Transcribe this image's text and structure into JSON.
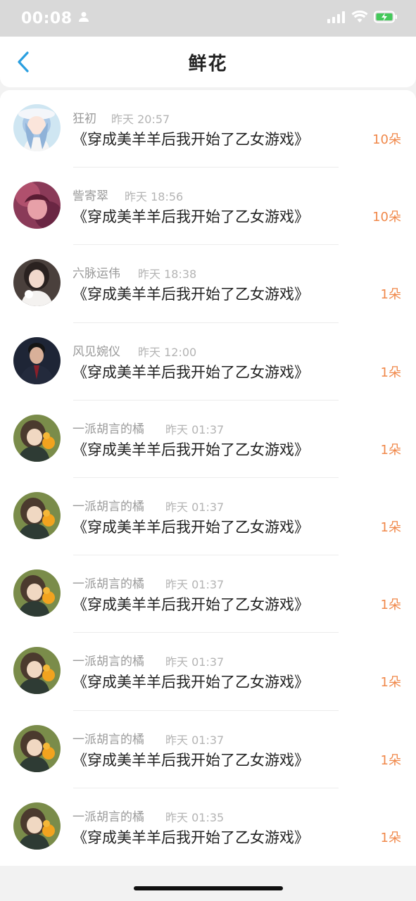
{
  "status_bar": {
    "time": "00:08"
  },
  "nav": {
    "title": "鲜花",
    "back_icon": "chevron-left-icon"
  },
  "colors": {
    "accent": "#2a9fe0",
    "count": "#f0884a",
    "battery": "#44c95a"
  },
  "records": [
    {
      "name": "狂初",
      "time": "昨天 20:57",
      "book": "《穿成美羊羊后我开始了乙女游戏》",
      "count": "10朵",
      "avatar": "anime-girl"
    },
    {
      "name": "訾寄翠",
      "time": "昨天 18:56",
      "book": "《穿成美羊羊后我开始了乙女游戏》",
      "count": "10朵",
      "avatar": "pink-girl"
    },
    {
      "name": "六脉运伟",
      "time": "昨天 18:38",
      "book": "《穿成美羊羊后我开始了乙女游戏》",
      "count": "1朵",
      "avatar": "woman-photo"
    },
    {
      "name": "风见婉仪",
      "time": "昨天 12:00",
      "book": "《穿成美羊羊后我开始了乙女游戏》",
      "count": "1朵",
      "avatar": "man-suit"
    },
    {
      "name": "一派胡言的橘",
      "time": "昨天 01:37",
      "book": "《穿成美羊羊后我开始了乙女游戏》",
      "count": "1朵",
      "avatar": "girl-orange"
    },
    {
      "name": "一派胡言的橘",
      "time": "昨天 01:37",
      "book": "《穿成美羊羊后我开始了乙女游戏》",
      "count": "1朵",
      "avatar": "girl-orange"
    },
    {
      "name": "一派胡言的橘",
      "time": "昨天 01:37",
      "book": "《穿成美羊羊后我开始了乙女游戏》",
      "count": "1朵",
      "avatar": "girl-orange"
    },
    {
      "name": "一派胡言的橘",
      "time": "昨天 01:37",
      "book": "《穿成美羊羊后我开始了乙女游戏》",
      "count": "1朵",
      "avatar": "girl-orange"
    },
    {
      "name": "一派胡言的橘",
      "time": "昨天 01:37",
      "book": "《穿成美羊羊后我开始了乙女游戏》",
      "count": "1朵",
      "avatar": "girl-orange"
    },
    {
      "name": "一派胡言的橘",
      "time": "昨天 01:35",
      "book": "《穿成美羊羊后我开始了乙女游戏》",
      "count": "1朵",
      "avatar": "girl-orange"
    }
  ]
}
